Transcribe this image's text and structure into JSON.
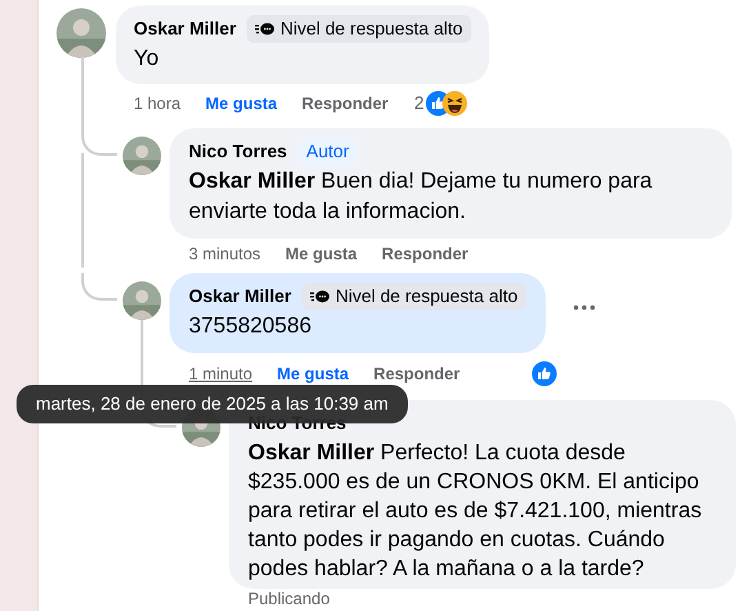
{
  "comments": [
    {
      "author": "Oskar Miller",
      "badge": {
        "kind": "response",
        "text": "Nivel de respuesta alto"
      },
      "text": "Yo",
      "highlighted": false,
      "time": "1 hora",
      "time_hovered": false,
      "like_label": "Me gusta",
      "liked": true,
      "reply_label": "Responder",
      "reactions": {
        "count": "2",
        "icons": [
          {
            "kind": "like"
          },
          {
            "kind": "haha"
          }
        ]
      },
      "more_options": false,
      "children": [
        {
          "author": "Nico Torres",
          "badge": {
            "kind": "author",
            "text": "Autor"
          },
          "text": "**Oskar Miller** Buen dia! Dejame tu numero para enviarte toda la informacion.",
          "highlighted": false,
          "time": "3 minutos",
          "time_hovered": false,
          "like_label": "Me gusta",
          "liked": false,
          "reply_label": "Responder",
          "more_options": false
        },
        {
          "author": "Oskar Miller",
          "badge": {
            "kind": "response",
            "text": "Nivel de respuesta alto"
          },
          "text": "3755820586",
          "highlighted": true,
          "time": "1 minuto",
          "time_hovered": true,
          "like_label": "Me gusta",
          "liked": true,
          "reply_label": "Responder",
          "reactions": {
            "icons": [
              {
                "kind": "like"
              }
            ]
          },
          "more_options": true,
          "children": [
            {
              "author": "Nico Torres",
              "text": "**Oskar Miller** Perfecto! La cuota desde $235.000 es de un CRONOS 0KM. El anticipo para retirar el auto es de $7.421.100, mientras tanto podes ir pagando en cuotas. Cuándo podes hablar? A la mañana o a la tarde?",
              "highlighted": false,
              "status": "Publicando",
              "more_options": false
            }
          ]
        }
      ]
    }
  ],
  "tooltip": {
    "text": "martes, 28 de enero de 2025 a las 10:39 am"
  }
}
